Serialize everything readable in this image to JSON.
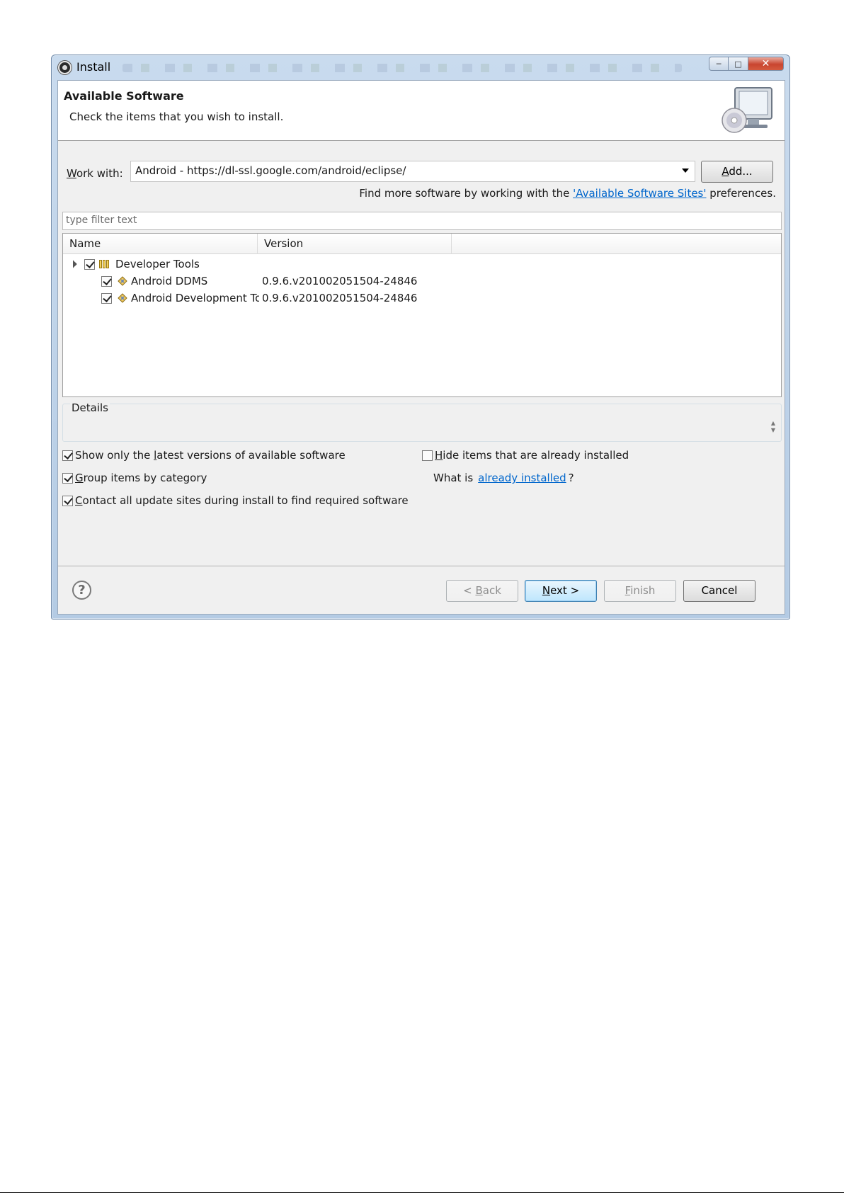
{
  "window": {
    "title": "Install"
  },
  "banner": {
    "title": "Available Software",
    "description": "Check the items that you wish to install."
  },
  "work_with": {
    "label": "Work with:",
    "value": "Android - https://dl-ssl.google.com/android/eclipse/",
    "add_button": "Add..."
  },
  "find_more": {
    "prefix": "Find more software by working with the ",
    "link": "'Available Software Sites'",
    "suffix": " preferences."
  },
  "filter": {
    "placeholder": "type filter text"
  },
  "tree": {
    "columns": [
      "Name",
      "Version"
    ],
    "rows": [
      {
        "name": "Developer Tools",
        "version": "",
        "checked": true,
        "expanded": true
      },
      {
        "name": "Android DDMS",
        "version": "0.9.6.v201002051504-24846",
        "checked": true
      },
      {
        "name": "Android Development Tool",
        "version": "0.9.6.v201002051504-24846",
        "checked": true
      }
    ]
  },
  "details": {
    "label": "Details"
  },
  "options": {
    "show_latest": {
      "label": "Show only the latest versions of available software",
      "checked": true
    },
    "group_by_category": {
      "label": "Group items by category",
      "checked": true
    },
    "contact_all": {
      "label": "Contact all update sites during install to find required software",
      "checked": true
    },
    "hide_installed": {
      "label": "Hide items that are already installed",
      "checked": false
    },
    "what_is_prefix": "What is ",
    "what_is_link": "already installed",
    "what_is_suffix": "?"
  },
  "buttons": {
    "back": "< Back",
    "next": "Next >",
    "finish": "Finish",
    "cancel": "Cancel"
  },
  "icons": {
    "help": "help-icon",
    "app": "eclipse-icon",
    "banner": "monitor-cd-icon"
  }
}
